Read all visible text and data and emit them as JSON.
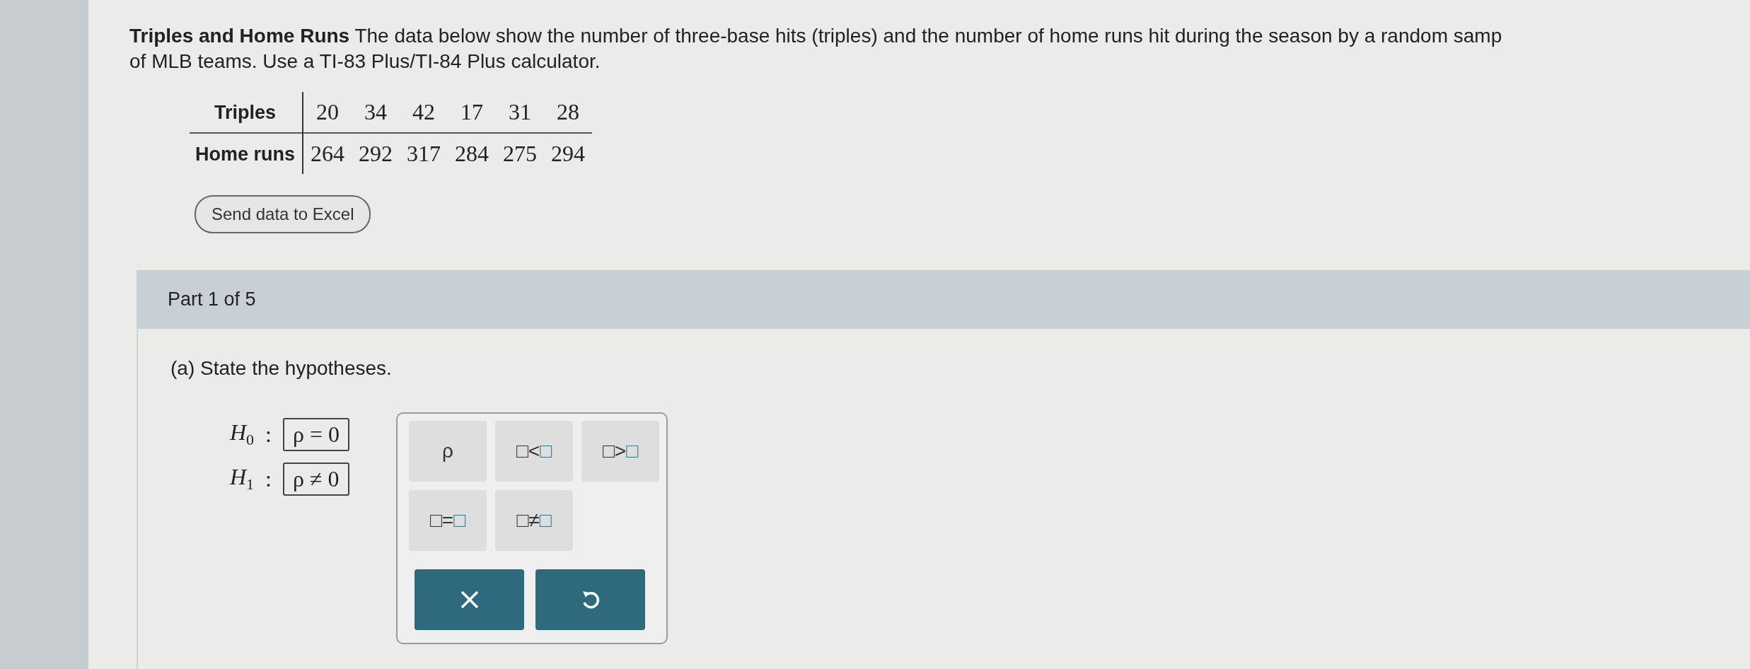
{
  "intro": {
    "lines": [
      "**Triples and Home Runs** The data below show the number of three-base hits (triples) and the number of home runs hit during the season by a random samp",
      "of MLB teams. Use a TI-83 Plus/TI-84 Plus calculator."
    ]
  },
  "table": {
    "rows": [
      {
        "header": "Triples",
        "cells": [
          "20",
          "34",
          "42",
          "17",
          "31",
          "28"
        ]
      },
      {
        "header": "Home runs",
        "cells": [
          "264",
          "292",
          "317",
          "284",
          "275",
          "294"
        ]
      }
    ]
  },
  "excel_button": "Send data to Excel",
  "part": {
    "title": "Part 1 of 5"
  },
  "question": "(a) State the hypotheses.",
  "hypotheses": [
    {
      "symbol": "H",
      "sub": "0",
      "separator": ":",
      "answer": "ρ = 0"
    },
    {
      "symbol": "H",
      "sub": "1",
      "separator": ":",
      "answer": "ρ ≠ 0"
    }
  ],
  "palette": {
    "keys": [
      {
        "kind": "symbol",
        "label": "ρ"
      },
      {
        "kind": "relation",
        "left": "□",
        "op": "<",
        "right": "□"
      },
      {
        "kind": "relation",
        "left": "□",
        "op": ">",
        "right": "□"
      },
      {
        "kind": "relation",
        "left": "□",
        "op": "=",
        "right": "□"
      },
      {
        "kind": "relation",
        "left": "□",
        "op": "≠",
        "right": "□"
      }
    ],
    "actions": [
      {
        "kind": "clear"
      },
      {
        "kind": "undo"
      }
    ]
  }
}
